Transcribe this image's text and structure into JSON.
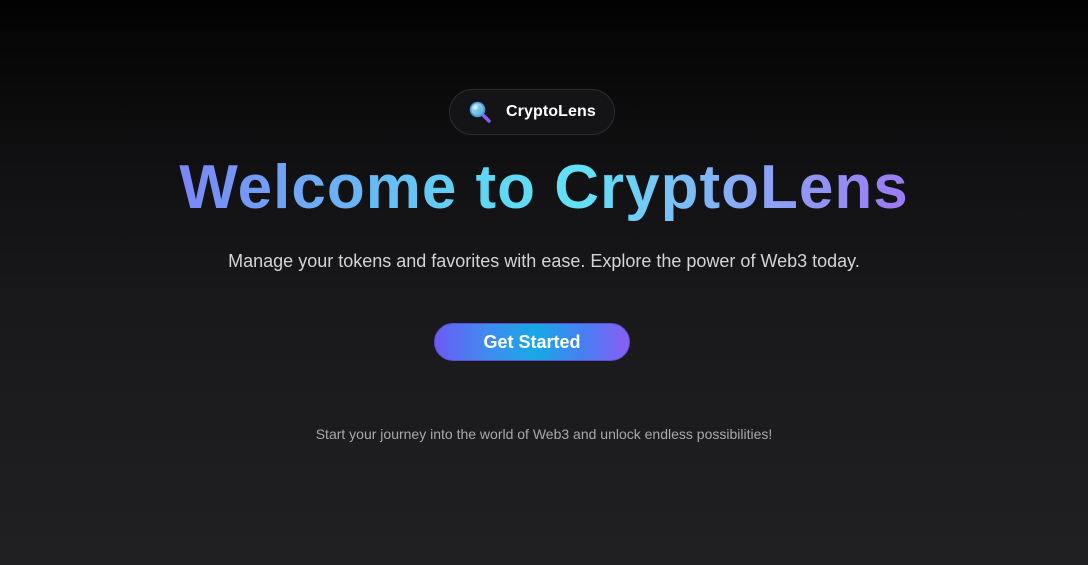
{
  "brand": {
    "name": "CryptoLens",
    "icon": "magnifying-glass-icon"
  },
  "hero": {
    "title": "Welcome to CryptoLens",
    "subtitle": "Manage your tokens and favorites with ease. Explore the power of Web3 today.",
    "cta_label": "Get Started",
    "tagline": "Start your journey into the world of Web3 and unlock endless possibilities!"
  },
  "colors": {
    "background_top": "#020202",
    "background_bottom": "#202022",
    "title_gradient": [
      "#7b86f7",
      "#5fd5f4",
      "#9c79f2"
    ],
    "cta_gradient": [
      "#6a5cf5",
      "#16a9e6",
      "#8a5ef7"
    ]
  }
}
